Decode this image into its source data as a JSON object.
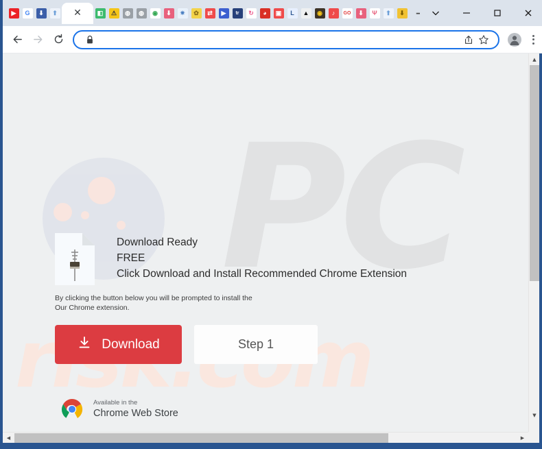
{
  "browser": {
    "window_controls": {
      "tab_search": "⌄",
      "minimize": "—",
      "maximize": "□",
      "close": "✕"
    },
    "active_tab": {
      "close_label": "✕",
      "title": ""
    },
    "new_tab_label": "+",
    "pinned_tabs": [
      {
        "name": "youtube",
        "glyph": "▶",
        "bg": "#ec2227",
        "fg": "#ffffff"
      },
      {
        "name": "google",
        "glyph": "G",
        "bg": "#ffffff",
        "fg": "#4285f4"
      },
      {
        "name": "downloader-1",
        "glyph": "⬇",
        "bg": "#3b5ea8",
        "fg": "#ffffff"
      },
      {
        "name": "uploader-cloud",
        "glyph": "⬆",
        "bg": "#eef3fa",
        "fg": "#6c9fd8"
      },
      {
        "name": "green-square",
        "glyph": "◧",
        "bg": "#3dbb6e",
        "fg": "#ffffff"
      },
      {
        "name": "warning",
        "glyph": "⚠",
        "bg": "#f5c518",
        "fg": "#3a3a3a"
      },
      {
        "name": "globe-grey-1",
        "glyph": "◍",
        "bg": "#9aa0a6",
        "fg": "#ffffff"
      },
      {
        "name": "globe-grey-2",
        "glyph": "◍",
        "bg": "#9aa0a6",
        "fg": "#ffffff"
      },
      {
        "name": "chrome",
        "glyph": "◉",
        "bg": "#ffffff",
        "fg": "#34a853"
      },
      {
        "name": "downloader-2",
        "glyph": "⬇",
        "bg": "#e8617d",
        "fg": "#ffffff"
      },
      {
        "name": "settings-gear",
        "glyph": "✷",
        "bg": "#eaf2fb",
        "fg": "#4a7fc1"
      },
      {
        "name": "yellow-blob",
        "glyph": "✿",
        "bg": "#f3d34a",
        "fg": "#8a6d1a"
      },
      {
        "name": "swap-arrows",
        "glyph": "⇄",
        "bg": "#ef4b4b",
        "fg": "#ffffff"
      },
      {
        "name": "video-player",
        "glyph": "▶",
        "bg": "#3c5fd0",
        "fg": "#ffffff"
      },
      {
        "name": "tr-logo",
        "glyph": "tr",
        "bg": "#27407a",
        "fg": "#ffffff"
      },
      {
        "name": "refresh-pink",
        "glyph": "↻",
        "bg": "#ffffff",
        "fg": "#ec5b8e"
      },
      {
        "name": "timer-red",
        "glyph": "◕",
        "bg": "#d93025",
        "fg": "#ffffff"
      },
      {
        "name": "recorder",
        "glyph": "▣",
        "bg": "#ef4b4b",
        "fg": "#ffffff"
      },
      {
        "name": "letter-l",
        "glyph": "L",
        "bg": "#e8f0fe",
        "fg": "#2a5590"
      },
      {
        "name": "black-triangle",
        "glyph": "▲",
        "bg": "#eef0f1",
        "fg": "#111111"
      },
      {
        "name": "target-dark",
        "glyph": "◉",
        "bg": "#3d3326",
        "fg": "#f5c518"
      },
      {
        "name": "play-red",
        "glyph": "♪",
        "bg": "#ef4b4b",
        "fg": "#ffffff"
      },
      {
        "name": "go-badge",
        "glyph": "GO",
        "bg": "#ffffff",
        "fg": "#e03b3b"
      },
      {
        "name": "downloader-3",
        "glyph": "⬇",
        "bg": "#e8617d",
        "fg": "#ffffff"
      },
      {
        "name": "ym-logo",
        "glyph": "Ψ",
        "bg": "#ffffff",
        "fg": "#e8617d"
      },
      {
        "name": "uploader-2",
        "glyph": "⬆",
        "bg": "#eef3fa",
        "fg": "#6c9fd8"
      },
      {
        "name": "downloader-4",
        "glyph": "⬇",
        "bg": "#f1c232",
        "fg": "#7a5c00"
      }
    ],
    "toolbar": {
      "back_label": "Back",
      "forward_label": "Forward",
      "reload_label": "Reload",
      "site_security": "lock-icon",
      "share_label": "Share this page",
      "bookmark_label": "Bookmark this tab",
      "profile_label": "Profile",
      "menu_label": "Customize and control Google Chrome"
    },
    "omnibox": {
      "value": "",
      "placeholder": ""
    }
  },
  "page": {
    "watermarks": {
      "primary": "PC",
      "secondary": "risk.com"
    },
    "hero": {
      "icon_name": "download-file-icon",
      "line1": "Download Ready",
      "line2": "FREE",
      "line3": "Click Download and Install Recommended Chrome Extension"
    },
    "disclaimer_line1": "By clicking the button below you will be prompted to install the",
    "disclaimer_line2": "Our Chrome extension.",
    "buttons": {
      "download_label": "Download",
      "download_icon": "download-arrow-icon",
      "download_color": "#dc3c41",
      "step_label": "Step 1"
    },
    "chrome_web_store": {
      "line1": "Available in the",
      "line2": "Chrome Web Store",
      "logo_name": "chrome-logo"
    }
  },
  "scrollbars": {
    "vertical": {
      "up": "▲",
      "down": "▼"
    },
    "horizontal": {
      "left": "◀",
      "right": "▶"
    }
  }
}
